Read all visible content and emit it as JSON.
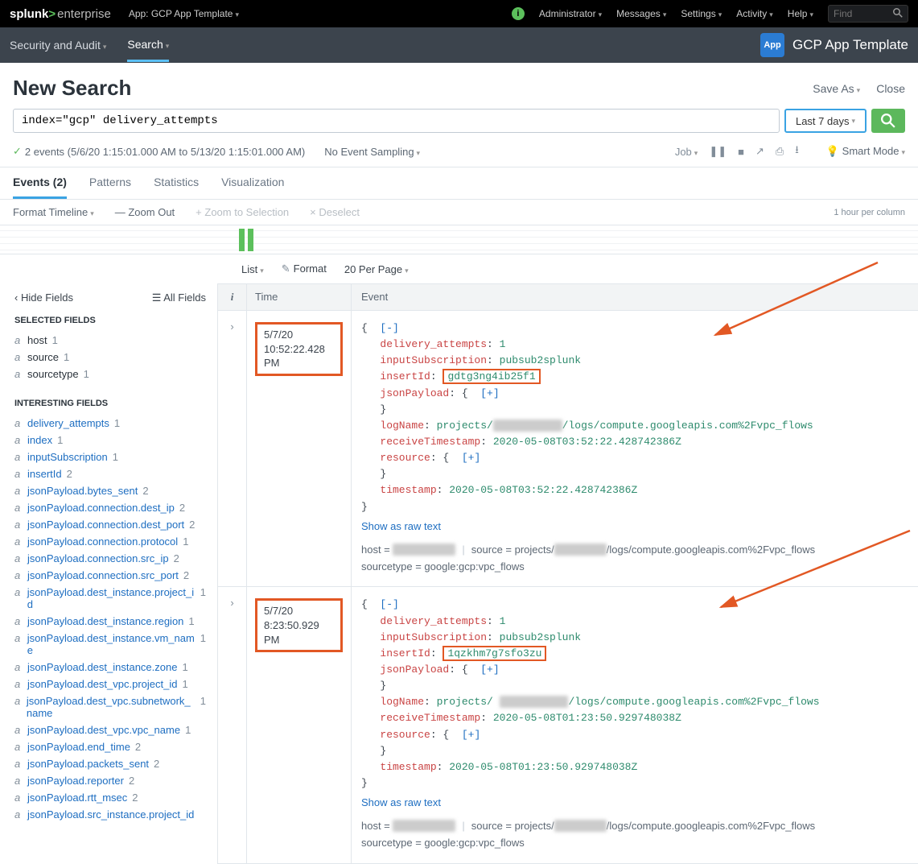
{
  "top": {
    "brand_left": "splunk",
    "brand_gt": ">",
    "brand_right": "enterprise",
    "app_label": "App: GCP App Template",
    "menus": [
      "Administrator",
      "Messages",
      "Settings",
      "Activity",
      "Help"
    ],
    "find_placeholder": "Find"
  },
  "appbar": {
    "items": [
      "Security and Audit",
      "Search"
    ],
    "active_index": 1,
    "app_icon_text": "App",
    "app_title": "GCP App Template"
  },
  "title": {
    "heading": "New Search",
    "save_as": "Save As",
    "close": "Close"
  },
  "search": {
    "query": "index=\"gcp\" delivery_attempts",
    "timerange": "Last 7 days"
  },
  "info": {
    "events_summary": "2 events (5/6/20 1:15:01.000 AM to 5/13/20 1:15:01.000 AM)",
    "sampling": "No Event Sampling",
    "job": "Job",
    "smart": "Smart Mode"
  },
  "restabs": {
    "events": "Events (2)",
    "patterns": "Patterns",
    "statistics": "Statistics",
    "visualization": "Visualization"
  },
  "tlctrl": {
    "format": "Format Timeline",
    "zoomout": "Zoom Out",
    "zoomsel": "Zoom to Selection",
    "deselect": "Deselect",
    "per": "1 hour per column"
  },
  "listctrl": {
    "list": "List",
    "format": "Format",
    "perpage": "20 Per Page"
  },
  "fields_panel": {
    "hide": "Hide Fields",
    "all": "All Fields",
    "selected_label": "SELECTED FIELDS",
    "interesting_label": "INTERESTING FIELDS",
    "selected": [
      {
        "type": "a",
        "name": "host",
        "count": "1"
      },
      {
        "type": "a",
        "name": "source",
        "count": "1"
      },
      {
        "type": "a",
        "name": "sourcetype",
        "count": "1"
      }
    ],
    "interesting": [
      {
        "type": "a",
        "name": "delivery_attempts",
        "count": "1"
      },
      {
        "type": "a",
        "name": "index",
        "count": "1"
      },
      {
        "type": "a",
        "name": "inputSubscription",
        "count": "1"
      },
      {
        "type": "a",
        "name": "insertId",
        "count": "2"
      },
      {
        "type": "a",
        "name": "jsonPayload.bytes_sent",
        "count": "2"
      },
      {
        "type": "a",
        "name": "jsonPayload.connection.dest_ip",
        "count": "2"
      },
      {
        "type": "a",
        "name": "jsonPayload.connection.dest_port",
        "count": "2"
      },
      {
        "type": "a",
        "name": "jsonPayload.connection.protocol",
        "count": "1"
      },
      {
        "type": "a",
        "name": "jsonPayload.connection.src_ip",
        "count": "2"
      },
      {
        "type": "a",
        "name": "jsonPayload.connection.src_port",
        "count": "2"
      },
      {
        "type": "a",
        "name": "jsonPayload.dest_instance.project_id",
        "count": "1"
      },
      {
        "type": "a",
        "name": "jsonPayload.dest_instance.region",
        "count": "1"
      },
      {
        "type": "a",
        "name": "jsonPayload.dest_instance.vm_name",
        "count": "1"
      },
      {
        "type": "a",
        "name": "jsonPayload.dest_instance.zone",
        "count": "1"
      },
      {
        "type": "a",
        "name": "jsonPayload.dest_vpc.project_id",
        "count": "1"
      },
      {
        "type": "a",
        "name": "jsonPayload.dest_vpc.subnetwork_name",
        "count": "1"
      },
      {
        "type": "a",
        "name": "jsonPayload.dest_vpc.vpc_name",
        "count": "1"
      },
      {
        "type": "a",
        "name": "jsonPayload.end_time",
        "count": "2"
      },
      {
        "type": "a",
        "name": "jsonPayload.packets_sent",
        "count": "2"
      },
      {
        "type": "a",
        "name": "jsonPayload.reporter",
        "count": "2"
      },
      {
        "type": "a",
        "name": "jsonPayload.rtt_msec",
        "count": "2"
      },
      {
        "type": "a",
        "name": "jsonPayload.src_instance.project_id",
        "count": ""
      }
    ]
  },
  "ehead": {
    "i": "i",
    "time": "Time",
    "event": "Event"
  },
  "events": [
    {
      "date": "5/7/20",
      "time": "10:52:22.428 PM",
      "delivery_attempts": "1",
      "inputSubscription": "pubsub2splunk",
      "insertId": "gdtg3ng4ib25f1",
      "logName_prefix": "projects/",
      "logName_suffix": "/logs/compute.googleapis.com%2Fvpc_flows",
      "receiveTimestamp": "2020-05-08T03:52:22.428742386Z",
      "timestamp": "2020-05-08T03:52:22.428742386Z",
      "raw": "Show as raw text",
      "host_label": "host = ",
      "source_label": "source = projects/",
      "source_suffix": "/logs/compute.googleapis.com%2Fvpc_flows",
      "sourcetype_label": "sourcetype = google:gcp:vpc_flows"
    },
    {
      "date": "5/7/20",
      "time": "8:23:50.929 PM",
      "delivery_attempts": "1",
      "inputSubscription": "pubsub2splunk",
      "insertId": "1qzkhm7g7sfo3zu",
      "logName_prefix": "projects/ ",
      "logName_suffix": "/logs/compute.googleapis.com%2Fvpc_flows",
      "receiveTimestamp": "2020-05-08T01:23:50.929748038Z",
      "timestamp": "2020-05-08T01:23:50.929748038Z",
      "raw": "Show as raw text",
      "host_label": "host = ",
      "source_label": "source = projects/",
      "source_suffix": "/logs/compute.googleapis.com%2Fvpc_flows",
      "sourcetype_label": "sourcetype = google:gcp:vpc_flows"
    }
  ]
}
